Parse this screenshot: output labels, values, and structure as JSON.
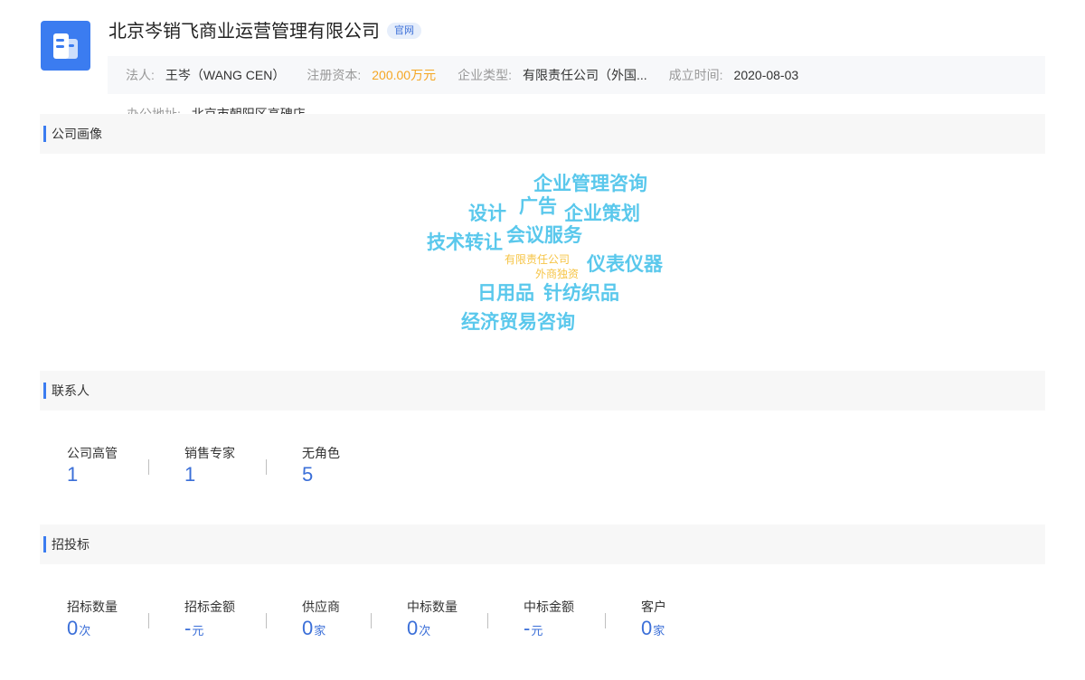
{
  "company": {
    "name": "北京岑销飞商业运营管理有限公司",
    "official_badge": "官网"
  },
  "info": {
    "legal_person_label": "法人:",
    "legal_person_value": "王岑（WANG CEN）",
    "capital_label": "注册资本:",
    "capital_value": "200.00万元",
    "type_label": "企业类型:",
    "type_value": "有限责任公司（外国...",
    "founded_label": "成立时间:",
    "founded_value": "2020-08-03",
    "address_label": "办公地址:",
    "address_value": "北京市朝阳区高碑店"
  },
  "colors": {
    "accent": "#3b7cf0",
    "cloud_blue": "#5ac8ec",
    "cloud_orange": "#f6c445",
    "capital_orange": "#f5a623"
  },
  "portrait": {
    "title": "公司画像",
    "words": [
      "企业管理咨询",
      "设计",
      "广告",
      "企业策划",
      "技术转让",
      "会议服务",
      "有限责任公司",
      "外商独资",
      "仪表仪器",
      "日用品",
      "针纺织品",
      "经济贸易咨询"
    ]
  },
  "contacts": {
    "title": "联系人",
    "stats": [
      {
        "label": "公司高管",
        "value": "1"
      },
      {
        "label": "销售专家",
        "value": "1"
      },
      {
        "label": "无角色",
        "value": "5"
      }
    ]
  },
  "bidding": {
    "title": "招投标",
    "stats": [
      {
        "label": "招标数量",
        "value": "0",
        "unit": "次"
      },
      {
        "label": "招标金额",
        "value": "-",
        "unit": "元"
      },
      {
        "label": "供应商",
        "value": "0",
        "unit": "家"
      },
      {
        "label": "中标数量",
        "value": "0",
        "unit": "次"
      },
      {
        "label": "中标金额",
        "value": "-",
        "unit": "元"
      },
      {
        "label": "客户",
        "value": "0",
        "unit": "家"
      }
    ]
  }
}
